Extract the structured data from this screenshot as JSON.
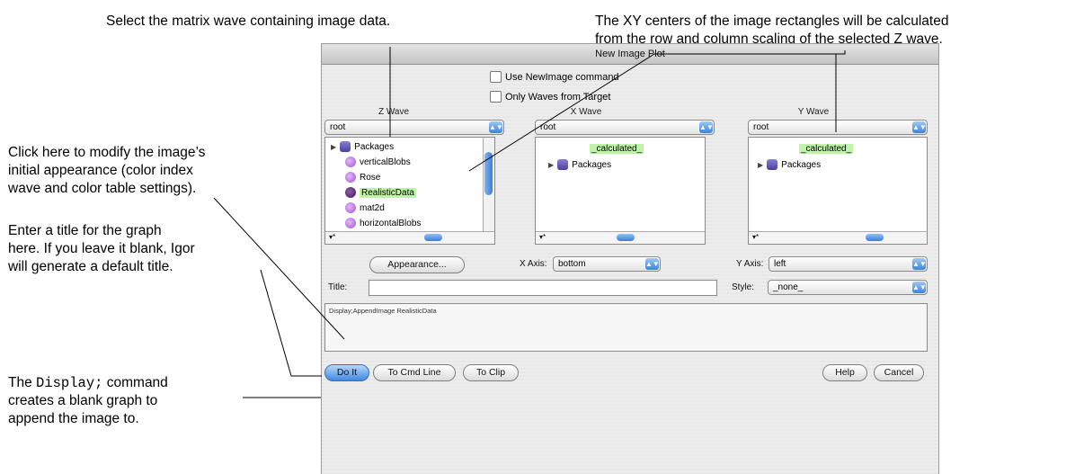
{
  "annotations": {
    "select_matrix": "Select the matrix wave containing image data.",
    "xy_centers_1": "The XY centers of the image rectangles will be calculated",
    "xy_centers_2": "from the row and column scaling of the selected Z wave.",
    "appearance_1": "Click here to modify the image’s",
    "appearance_2": "initial appearance (color index",
    "appearance_3": "wave and color table settings).",
    "title_1": "Enter a title for the graph",
    "title_2": "here. If you leave it blank, Igor",
    "title_3": "will generate a default title.",
    "display_pre": "The ",
    "display_code": "Display;",
    "display_post": " command",
    "display_2": "creates a blank graph to",
    "display_3": "append the image to."
  },
  "dialog": {
    "title": "New Image Plot",
    "use_newimage": "Use NewImage command",
    "only_waves": "Only Waves from Target",
    "z_wave_label": "Z Wave",
    "x_wave_label": "X Wave",
    "y_wave_label": "Y Wave",
    "z_folder": "root",
    "x_folder": "root",
    "y_folder": "root",
    "z_items": [
      "Packages",
      "verticalBlobs",
      "Rose",
      "RealisticData",
      "mat2d",
      "horizontalBlobs"
    ],
    "x_items": [
      "_calculated_",
      "Packages"
    ],
    "y_items": [
      "_calculated_",
      "Packages"
    ],
    "filter_glyph": "▾*",
    "appearance_button": "Appearance...",
    "x_axis_label": "X Axis:",
    "x_axis_value": "bottom",
    "y_axis_label": "Y Axis:",
    "y_axis_value": "left",
    "title_label": "Title:",
    "style_label": "Style:",
    "style_value": "_none_",
    "command_text": "Display;AppendImage RealisticData",
    "do_it": "Do It",
    "to_cmd_line": "To Cmd Line",
    "to_clip": "To Clip",
    "help": "Help",
    "cancel": "Cancel"
  }
}
